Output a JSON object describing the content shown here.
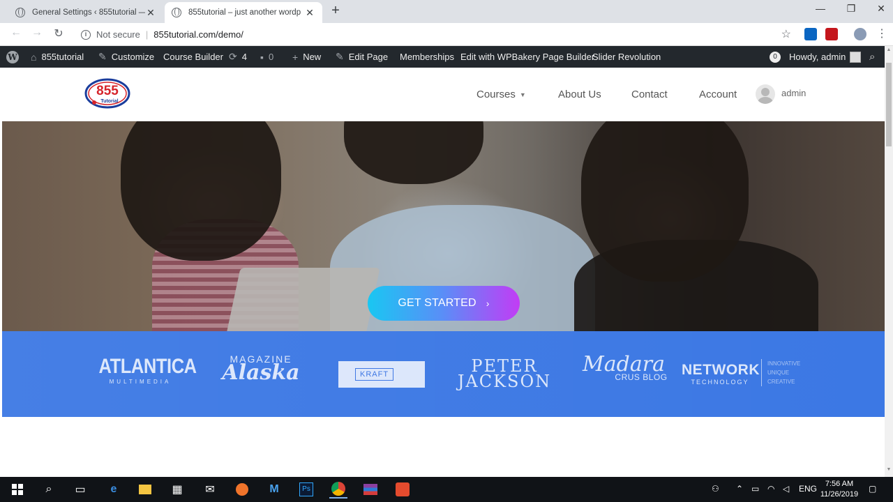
{
  "browser": {
    "tabs": [
      {
        "title": "General Settings ‹ 855tutorial —",
        "active": false
      },
      {
        "title": "855tutorial – just another wordp",
        "active": true
      }
    ],
    "new_tab": "+",
    "window_controls": {
      "minimize": "—",
      "restore": "❐",
      "close": "✕"
    },
    "address": {
      "security_label": "Not secure",
      "url": "855tutorial.com/demo/"
    }
  },
  "wp_admin_bar": {
    "site_name": "855tutorial",
    "customize": "Customize",
    "course_builder": "Course Builder",
    "updates_count": "4",
    "comments_count": "0",
    "new": "New",
    "edit_page": "Edit Page",
    "memberships": "Memberships",
    "edit_wpbakery": "Edit with WPBakery Page Builder",
    "slider_revolution": "Slider Revolution",
    "notification_count": "0",
    "howdy": "Howdy, admin"
  },
  "site_header": {
    "logo_text": "855",
    "logo_subtext": "Tutorial",
    "nav": {
      "courses": "Courses",
      "about": "About Us",
      "contact": "Contact",
      "account": "Account"
    },
    "user_name": "admin"
  },
  "hero": {
    "cta_label": "GET STARTED",
    "cta_colors": [
      "#19c7f2",
      "#c23cf5"
    ]
  },
  "partner_logos": {
    "atlantica": {
      "main": "ATLANTICA",
      "sub": "MULTIMEDIA"
    },
    "alaska": {
      "top": "MAGAZINE",
      "main": "Alaska"
    },
    "kraft": "KRAFT",
    "peter_jackson": {
      "line1": "PETER",
      "line2": "JACKSON"
    },
    "madara": {
      "main": "Madara",
      "sub": "CRUS BLOG"
    },
    "network": {
      "main": "NETWORK",
      "sub": "TECHNOLOGY",
      "side": [
        "INNOVATIVE",
        "UNIQUE",
        "CREATIVE"
      ]
    },
    "band_color": "#2b6ce2"
  },
  "taskbar": {
    "language": "ENG",
    "time": "7:56 AM",
    "date": "11/26/2019"
  }
}
